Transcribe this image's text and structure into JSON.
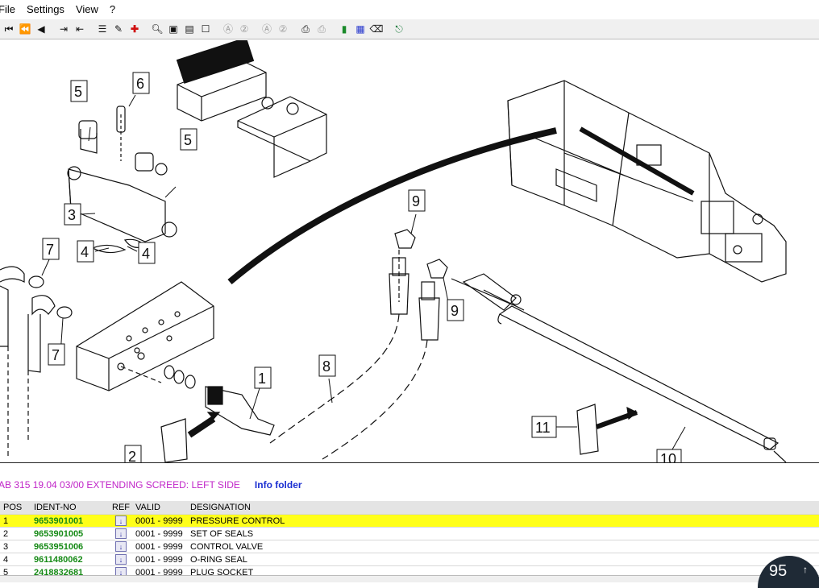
{
  "menu": [
    "File",
    "Settings",
    "View",
    "?"
  ],
  "toolbar_icons": [
    "first-page-icon",
    "prev-group-icon",
    "prev-icon",
    "export-icon",
    "import-icon",
    "print-list-icon",
    "edit-icon",
    "add-icon",
    "zoom-icon",
    "fit-page-icon",
    "fit-width-icon",
    "select-icon",
    "zoom-a-icon",
    "zoom-b-icon",
    "zoom-c-icon",
    "zoom-d-icon",
    "print-icon",
    "print-preview-icon",
    "book-icon",
    "grid-icon",
    "eraser-icon",
    "exit-icon"
  ],
  "callouts": {
    "c1": "1",
    "c2": "2",
    "c3": "3",
    "c4a": "4",
    "c4b": "4",
    "c5a": "5",
    "c5b": "5",
    "c6": "6",
    "c7a": "7",
    "c7b": "7",
    "c8": "8",
    "c9a": "9",
    "c9b": "9",
    "c10": "10",
    "c11": "11"
  },
  "info": {
    "title": "AB 315 19.04 03/00 EXTENDING SCREED: LEFT SIDE",
    "folder": "Info folder"
  },
  "table": {
    "headers": {
      "pos": "POS",
      "ident": "IDENT-NO",
      "ref": "REF",
      "valid": "VALID",
      "designation": "DESIGNATION"
    },
    "rows": [
      {
        "pos": "1",
        "ident": "9653901001",
        "valid": "0001 - 9999",
        "designation": "PRESSURE CONTROL"
      },
      {
        "pos": "2",
        "ident": "9653901005",
        "valid": "0001 - 9999",
        "designation": "SET OF SEALS"
      },
      {
        "pos": "3",
        "ident": "9653951006",
        "valid": "0001 - 9999",
        "designation": "CONTROL VALVE"
      },
      {
        "pos": "4",
        "ident": "9611480062",
        "valid": "0001 - 9999",
        "designation": "O-RING SEAL"
      },
      {
        "pos": "5",
        "ident": "2418832681",
        "valid": "0001 - 9999",
        "designation": "PLUG SOCKET"
      }
    ]
  },
  "badge": "95",
  "colors": {
    "selected_row": "#ffff1a",
    "ident_green": "#168a16",
    "title_magenta": "#c025c8",
    "folder_blue": "#1b2fd1"
  }
}
